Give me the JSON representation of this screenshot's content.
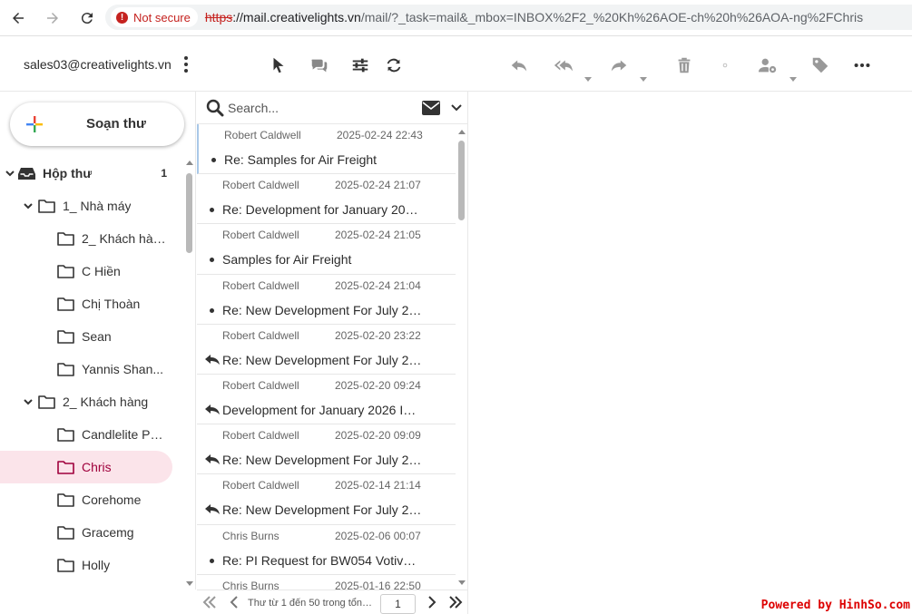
{
  "browser": {
    "security_label": "Not secure",
    "url_scheme": "https",
    "url_host": "://mail.creativelights.vn",
    "url_path": "/mail/?_task=mail&_mbox=INBOX%2F2_%20Kh%26AOE-ch%20h%26AOA-ng%2FChris"
  },
  "header": {
    "account": "sales03@creativelights.vn"
  },
  "compose": {
    "label": "Soạn thư"
  },
  "folders": [
    {
      "name": "Hộp thư",
      "count": "1",
      "level": 0,
      "expanded": true
    },
    {
      "name": "1_ Nhà máy",
      "level": 1,
      "expanded": true
    },
    {
      "name": "2_ Khách hàng",
      "level": 2
    },
    {
      "name": "C Hiền",
      "level": 2
    },
    {
      "name": "Chị Thoàn",
      "level": 2
    },
    {
      "name": "Sean",
      "level": 2
    },
    {
      "name": "Yannis Shan...",
      "level": 2
    },
    {
      "name": "2_ Khách hàng",
      "level": 1,
      "expanded": true
    },
    {
      "name": "Candlelite Pa...",
      "level": 2
    },
    {
      "name": "Chris",
      "level": 2,
      "selected": true
    },
    {
      "name": "Corehome",
      "level": 2
    },
    {
      "name": "Gracemg",
      "level": 2
    },
    {
      "name": "Holly",
      "level": 2
    }
  ],
  "search": {
    "placeholder": "Search..."
  },
  "messages": [
    {
      "from": "Robert Caldwell",
      "date": "2025-02-24 22:43",
      "subject": "Re: Samples for Air Freight",
      "status": "unread"
    },
    {
      "from": "Robert Caldwell",
      "date": "2025-02-24 21:07",
      "subject": "Re: Development for January 2026 Int...",
      "status": "unread"
    },
    {
      "from": "Robert Caldwell",
      "date": "2025-02-24 21:05",
      "subject": "Samples for Air Freight",
      "status": "unread"
    },
    {
      "from": "Robert Caldwell",
      "date": "2025-02-24 21:04",
      "subject": "Re: New Development For July 2025 ...",
      "status": "unread"
    },
    {
      "from": "Robert Caldwell",
      "date": "2025-02-20 23:22",
      "subject": "Re: New Development For July 2025 ...",
      "status": "replied"
    },
    {
      "from": "Robert Caldwell",
      "date": "2025-02-20 09:24",
      "subject": "Development for January 2026 Int...",
      "status": "replied"
    },
    {
      "from": "Robert Caldwell",
      "date": "2025-02-20 09:09",
      "subject": "Re: New Development For July 2025 ...",
      "status": "replied"
    },
    {
      "from": "Robert Caldwell",
      "date": "2025-02-14 21:14",
      "subject": "Re: New Development For July 2025 ...",
      "status": "replied"
    },
    {
      "from": "Chris Burns",
      "date": "2025-02-06 00:07",
      "subject": "Re: PI Request for BW054 Votives ...",
      "status": "unread"
    },
    {
      "from": "Chris Burns",
      "date": "2025-01-16 22:50",
      "subject": "",
      "status": "unread"
    }
  ],
  "pager": {
    "info": "Thư từ 1 đến 50 trong tổng số",
    "page": "1"
  },
  "watermark": "Powered by HinhSo.com",
  "colors": {
    "accent": "#a0003c",
    "selected_bg": "#fbe4ea",
    "not_secure": "#c5221f"
  }
}
